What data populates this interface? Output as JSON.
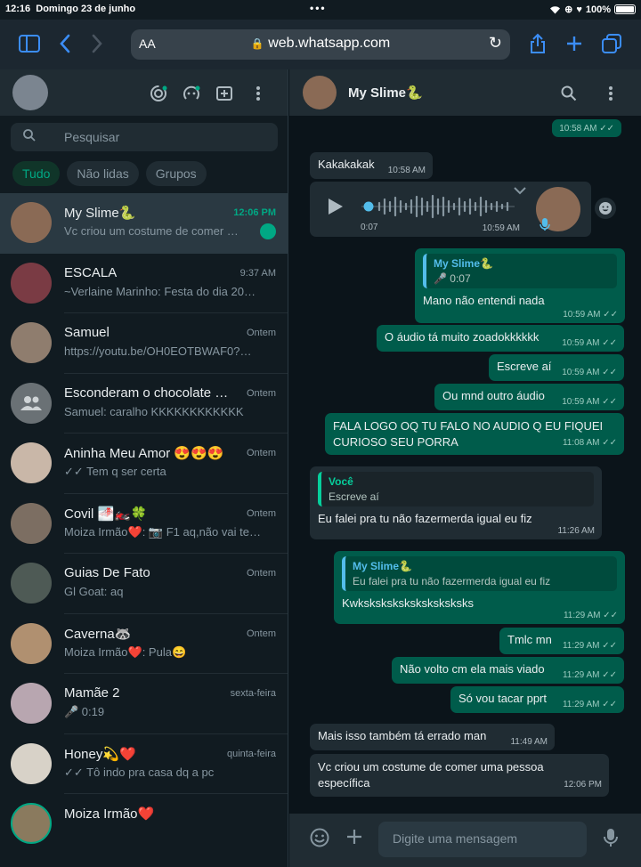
{
  "status": {
    "time": "12:16",
    "date": "Domingo 23 de junho",
    "dots": "•••",
    "battery": "100%"
  },
  "browser": {
    "url": "web.whatsapp.com",
    "aa": "AA"
  },
  "sidebar": {
    "search_placeholder": "Pesquisar",
    "filters": [
      "Tudo",
      "Não lidas",
      "Grupos"
    ],
    "chats": [
      {
        "name": "My Slime🐍",
        "time": "12:06 PM",
        "preview": "Vc criou um costume de comer …",
        "unread": true
      },
      {
        "name": "ESCALA",
        "time": "9:37 AM",
        "preview": "~Verlaine Marinho: Festa do dia 20…"
      },
      {
        "name": "Samuel",
        "time": "Ontem",
        "preview": "https://youtu.be/OH0EOTBWAF0?…"
      },
      {
        "name": "Esconderam o chocolate …",
        "time": "Ontem",
        "preview": "Samuel: caralho KKKKKKKKKKKK"
      },
      {
        "name": "Aninha Meu Amor 😍😍😍",
        "time": "Ontem",
        "preview": "✓✓ Tem q ser certa"
      },
      {
        "name": "Covil 🌁🏍️🍀",
        "time": "Ontem",
        "preview": "Moiza Irmão❤️: 📷 F1 aq,não vai te…"
      },
      {
        "name": "Guias De Fato",
        "time": "Ontem",
        "preview": "Gl Goat: aq"
      },
      {
        "name": "Caverna🦝",
        "time": "Ontem",
        "preview": "Moiza Irmão❤️: Pula😄"
      },
      {
        "name": "Mamãe 2",
        "time": "sexta-feira",
        "preview": "🎤 0:19"
      },
      {
        "name": "Honey💫❤️",
        "time": "quinta-feira",
        "preview": "✓✓ Tô indo pra casa dq a pc"
      },
      {
        "name": "Moiza Irmão❤️",
        "time": "",
        "preview": ""
      }
    ]
  },
  "conversation": {
    "contact": "My Slime🐍",
    "messages": [
      {
        "id": "m0",
        "dir": "out",
        "time": "10:58 AM ✓✓"
      },
      {
        "id": "m1",
        "dir": "in",
        "text": "Kakakakak",
        "time": "10:58 AM"
      },
      {
        "id": "m2",
        "dir": "in",
        "audio_elapsed": "0:07",
        "time": "10:59 AM"
      },
      {
        "id": "m3",
        "dir": "out",
        "quote_name": "My Slime🐍",
        "quote_text": "🎤 0:07",
        "text": "Mano não entendi nada",
        "time": "10:59 AM ✓✓"
      },
      {
        "id": "m4",
        "dir": "out",
        "text": "O áudio tá muito zoadokkkkkk",
        "time": "10:59 AM ✓✓"
      },
      {
        "id": "m5",
        "dir": "out",
        "text": "Escreve aí",
        "time": "10:59 AM ✓✓"
      },
      {
        "id": "m6",
        "dir": "out",
        "text": "Ou mnd outro áudio",
        "time": "10:59 AM ✓✓"
      },
      {
        "id": "m7",
        "dir": "out",
        "text": "FALA LOGO OQ TU FALO NO AUDIO Q EU FIQUEI CURIOSO SEU PORRA",
        "time": "11:08 AM ✓✓"
      },
      {
        "id": "m8",
        "dir": "in",
        "quote_name": "Você",
        "quote_text": "Escreve aí",
        "text": "Eu falei pra tu não fazermerda igual eu fiz",
        "time": "11:26 AM"
      },
      {
        "id": "m9",
        "dir": "out",
        "quote_name": "My Slime🐍",
        "quote_text": "Eu falei pra tu não fazermerda igual eu fiz",
        "text": "Kwksksksksksksksksksks",
        "time": "11:29 AM ✓✓"
      },
      {
        "id": "m10",
        "dir": "out",
        "text": "Tmlc mn",
        "time": "11:29 AM ✓✓"
      },
      {
        "id": "m11",
        "dir": "out",
        "text": "Não volto cm ela mais viado",
        "time": "11:29 AM ✓✓"
      },
      {
        "id": "m12",
        "dir": "out",
        "text": "Só vou tacar pprt",
        "time": "11:29 AM ✓✓"
      },
      {
        "id": "m13",
        "dir": "in",
        "text": "Mais isso também tá errado man",
        "time": "11:49 AM"
      },
      {
        "id": "m14",
        "dir": "in",
        "text": "Vc criou um costume de comer uma pessoa específica",
        "time": "12:06 PM"
      }
    ]
  },
  "composer": {
    "placeholder": "Digite uma mensagem"
  },
  "colors": {
    "accent": "#00a884",
    "outgoing": "#005c4b",
    "incoming": "#202c33",
    "panel": "#111b21"
  }
}
